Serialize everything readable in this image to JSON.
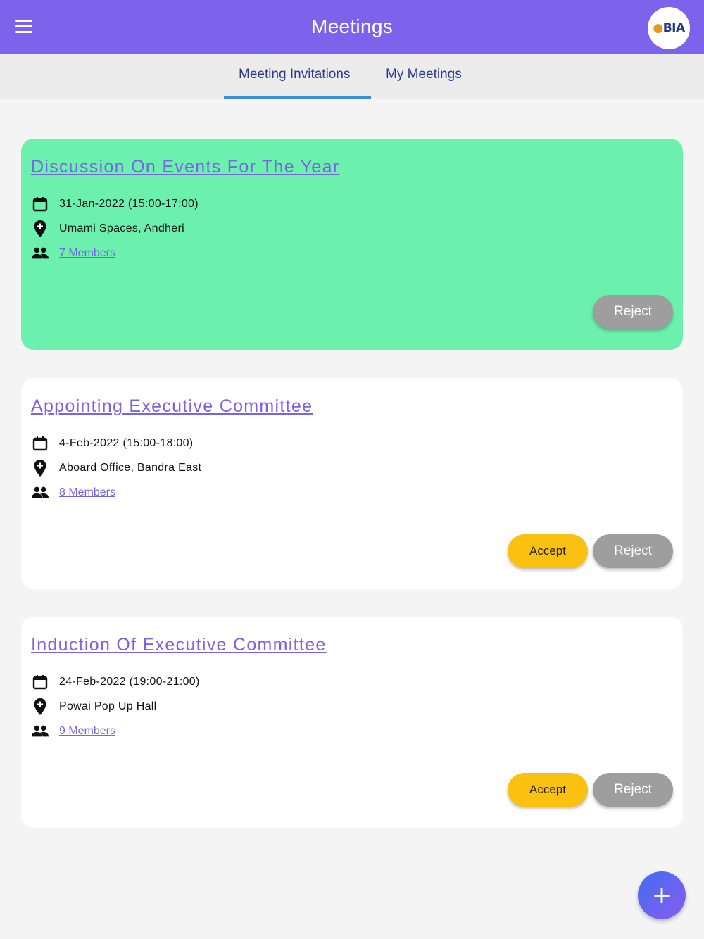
{
  "header": {
    "title": "Meetings",
    "logo_text": "BIA"
  },
  "tabs": [
    {
      "label": "Meeting Invitations",
      "active": true
    },
    {
      "label": "My Meetings",
      "active": false
    }
  ],
  "meetings": [
    {
      "title": "Discussion On Events For The Year",
      "date": "31-Jan-2022 (15:00-17:00)",
      "location": "Umami Spaces, Andheri",
      "members": "7 Members",
      "accept_label": "",
      "reject_label": "Reject",
      "background": "#6cf0ad"
    },
    {
      "title": "Appointing Executive Committee",
      "date": "4-Feb-2022 (15:00-18:00)",
      "location": "Aboard Office, Bandra East",
      "members": "8 Members",
      "accept_label": "Accept",
      "reject_label": "Reject",
      "background": "#ffffff"
    },
    {
      "title": "Induction Of Executive Committee",
      "date": "24-Feb-2022 (19:00-21:00)",
      "location": "Powai Pop Up Hall",
      "members": "9 Members",
      "accept_label": "Accept",
      "reject_label": "Reject",
      "background": "#ffffff"
    }
  ],
  "fab": {
    "icon": "plus-icon",
    "label": "+"
  },
  "colors": {
    "app_bar": "#7b63ec",
    "accent_link": "#7a63e6",
    "accept": "#fbc111",
    "reject": "#9e9e9e",
    "tab_indicator": "#3d8ed8"
  },
  "icons": {
    "menu": "menu-icon",
    "date": "calendar-icon",
    "location": "location-pin-icon",
    "members": "people-icon"
  }
}
